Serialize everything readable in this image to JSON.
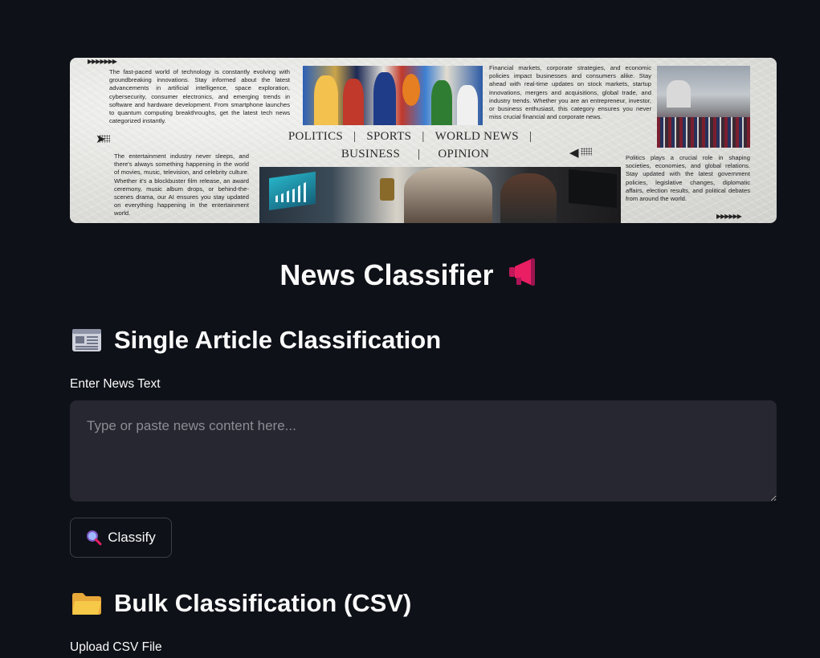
{
  "banner": {
    "categories_row1": [
      "POLITICS",
      "SPORTS",
      "WORLD NEWS"
    ],
    "categories_row2": [
      "BUSINESS",
      "OPINION"
    ],
    "separator": "|",
    "text_tech": "The fast-paced world of technology is constantly evolving with groundbreaking innovations. Stay informed about the latest advancements in artificial intelligence, space exploration, cybersecurity, consumer electronics, and emerging trends in software and hardware development. From smartphone launches to quantum computing breakthroughs, get the latest tech news categorized instantly.",
    "text_entertainment": "The entertainment industry never sleeps, and there's always something happening in the world of movies, music, television, and celebrity culture. Whether it's a blockbuster film release, an award ceremony, music album drops, or behind-the-scenes drama, our AI ensures you stay updated on everything happening in the entertainment world.",
    "text_business": "Financial markets, corporate strategies, and economic policies impact businesses and consumers alike. Stay ahead with real-time updates on stock markets, startup innovations, mergers and acquisitions, global trade, and industry trends. Whether you are an entrepreneur, investor, or business enthusiast, this category ensures you never miss crucial financial and corporate news.",
    "text_politics": "Politics plays a crucial role in shaping societies, economies, and global relations. Stay updated with the latest government policies, legislative changes, diplomatic affairs, election results, and political debates from around the world."
  },
  "title": "News Classifier",
  "title_icon": "megaphone-icon",
  "single": {
    "heading": "Single Article Classification",
    "icon": "newspaper-icon",
    "label": "Enter News Text",
    "placeholder": "Type or paste news content here...",
    "value": "",
    "button_label": "Classify",
    "button_icon": "magnifier-icon"
  },
  "bulk": {
    "heading": "Bulk Classification (CSV)",
    "icon": "folder-icon",
    "upload_label": "Upload CSV File"
  },
  "colors": {
    "background": "#0e1117",
    "input_bg": "#262730",
    "text": "#fafafa",
    "placeholder": "#8b8c94"
  }
}
